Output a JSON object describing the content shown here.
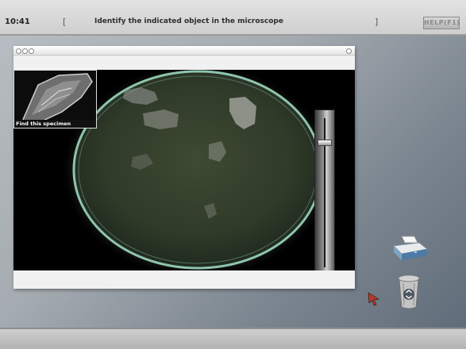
{
  "header": {
    "time": "10:41",
    "bracket_left": "[",
    "bracket_right": "]",
    "prompt": "Identify the indicated object in the microscope",
    "help_label": "HELP(F1)"
  },
  "specimen": {
    "caption": "Find this specimen"
  },
  "slider": {
    "level": 0.15
  },
  "desktop": {
    "icons": [
      "printer-icon",
      "trash-icon"
    ]
  },
  "colors": {
    "lens_ring": "#8fc4ad",
    "slide_green": "#3a432e"
  }
}
